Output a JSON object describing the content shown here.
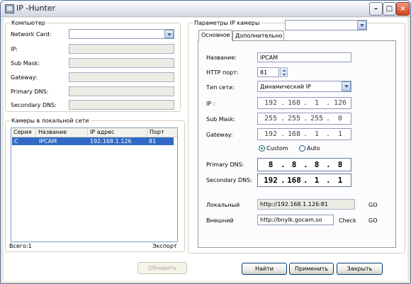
{
  "window": {
    "title": "IP -Hunter"
  },
  "computer": {
    "legend": "Компьютер",
    "network_card_label": "Network Card:",
    "network_card_value": "",
    "ip_label": "IP:",
    "submask_label": "Sub Mask:",
    "gateway_label": "Gateway:",
    "primary_dns_label": "Primary DNS:",
    "secondary_dns_label": "Secondary DNS:"
  },
  "cameras": {
    "legend": "Камеры в локальной сети",
    "columns": [
      "Серия",
      "Название",
      "IP адрес",
      "Порт"
    ],
    "rows": [
      {
        "series": "C",
        "name": "IPCAM",
        "ip": "192.168.1.126",
        "port": "81"
      }
    ],
    "total_label": "Всего:1",
    "export_label": "Экспорт"
  },
  "refresh_button": "Обновить",
  "camera_params": {
    "legend": "Параметры IP камеры",
    "selector_value": "",
    "tabs": [
      "Основное",
      "Дополнительно"
    ],
    "name_label": "Название:",
    "name_value": "IPCAM",
    "http_port_label": "HTTP порт:",
    "http_port_value": "81",
    "network_type_label": "Тип сети:",
    "network_type_value": "Динамический IP",
    "ip_label": "IP  :",
    "ip_octets": [
      "192",
      "168",
      "1",
      "126"
    ],
    "submask_label": "Sub Mask:",
    "submask_octets": [
      "255",
      "255",
      "255",
      "0"
    ],
    "gateway_label": "Gateway:",
    "gateway_octets": [
      "192",
      "168",
      "1",
      "1"
    ],
    "dns_mode_custom": "Custom",
    "dns_mode_auto": "Auto",
    "dns_mode_selected": "Custom",
    "primary_dns_label": "Primary DNS:",
    "primary_dns_octets": [
      "8",
      "8",
      "8",
      "8"
    ],
    "secondary_dns_label": "Secondary DNS:",
    "secondary_dns_octets": [
      "192",
      "168",
      "1",
      "1"
    ],
    "local_label": "Локальный",
    "local_url": "http://192.168.1.126:81",
    "local_go": "GO",
    "external_label": "Внешний",
    "external_url": "http://bnylk.gocam.so",
    "external_check": "Check",
    "external_go": "GO"
  },
  "footer": {
    "find": "Найти",
    "apply": "Применить",
    "close": "Закрыть"
  },
  "colors": {
    "selection": "#3169c6",
    "window_border": "#4e6a9c",
    "radio_dot": "#21a121"
  }
}
